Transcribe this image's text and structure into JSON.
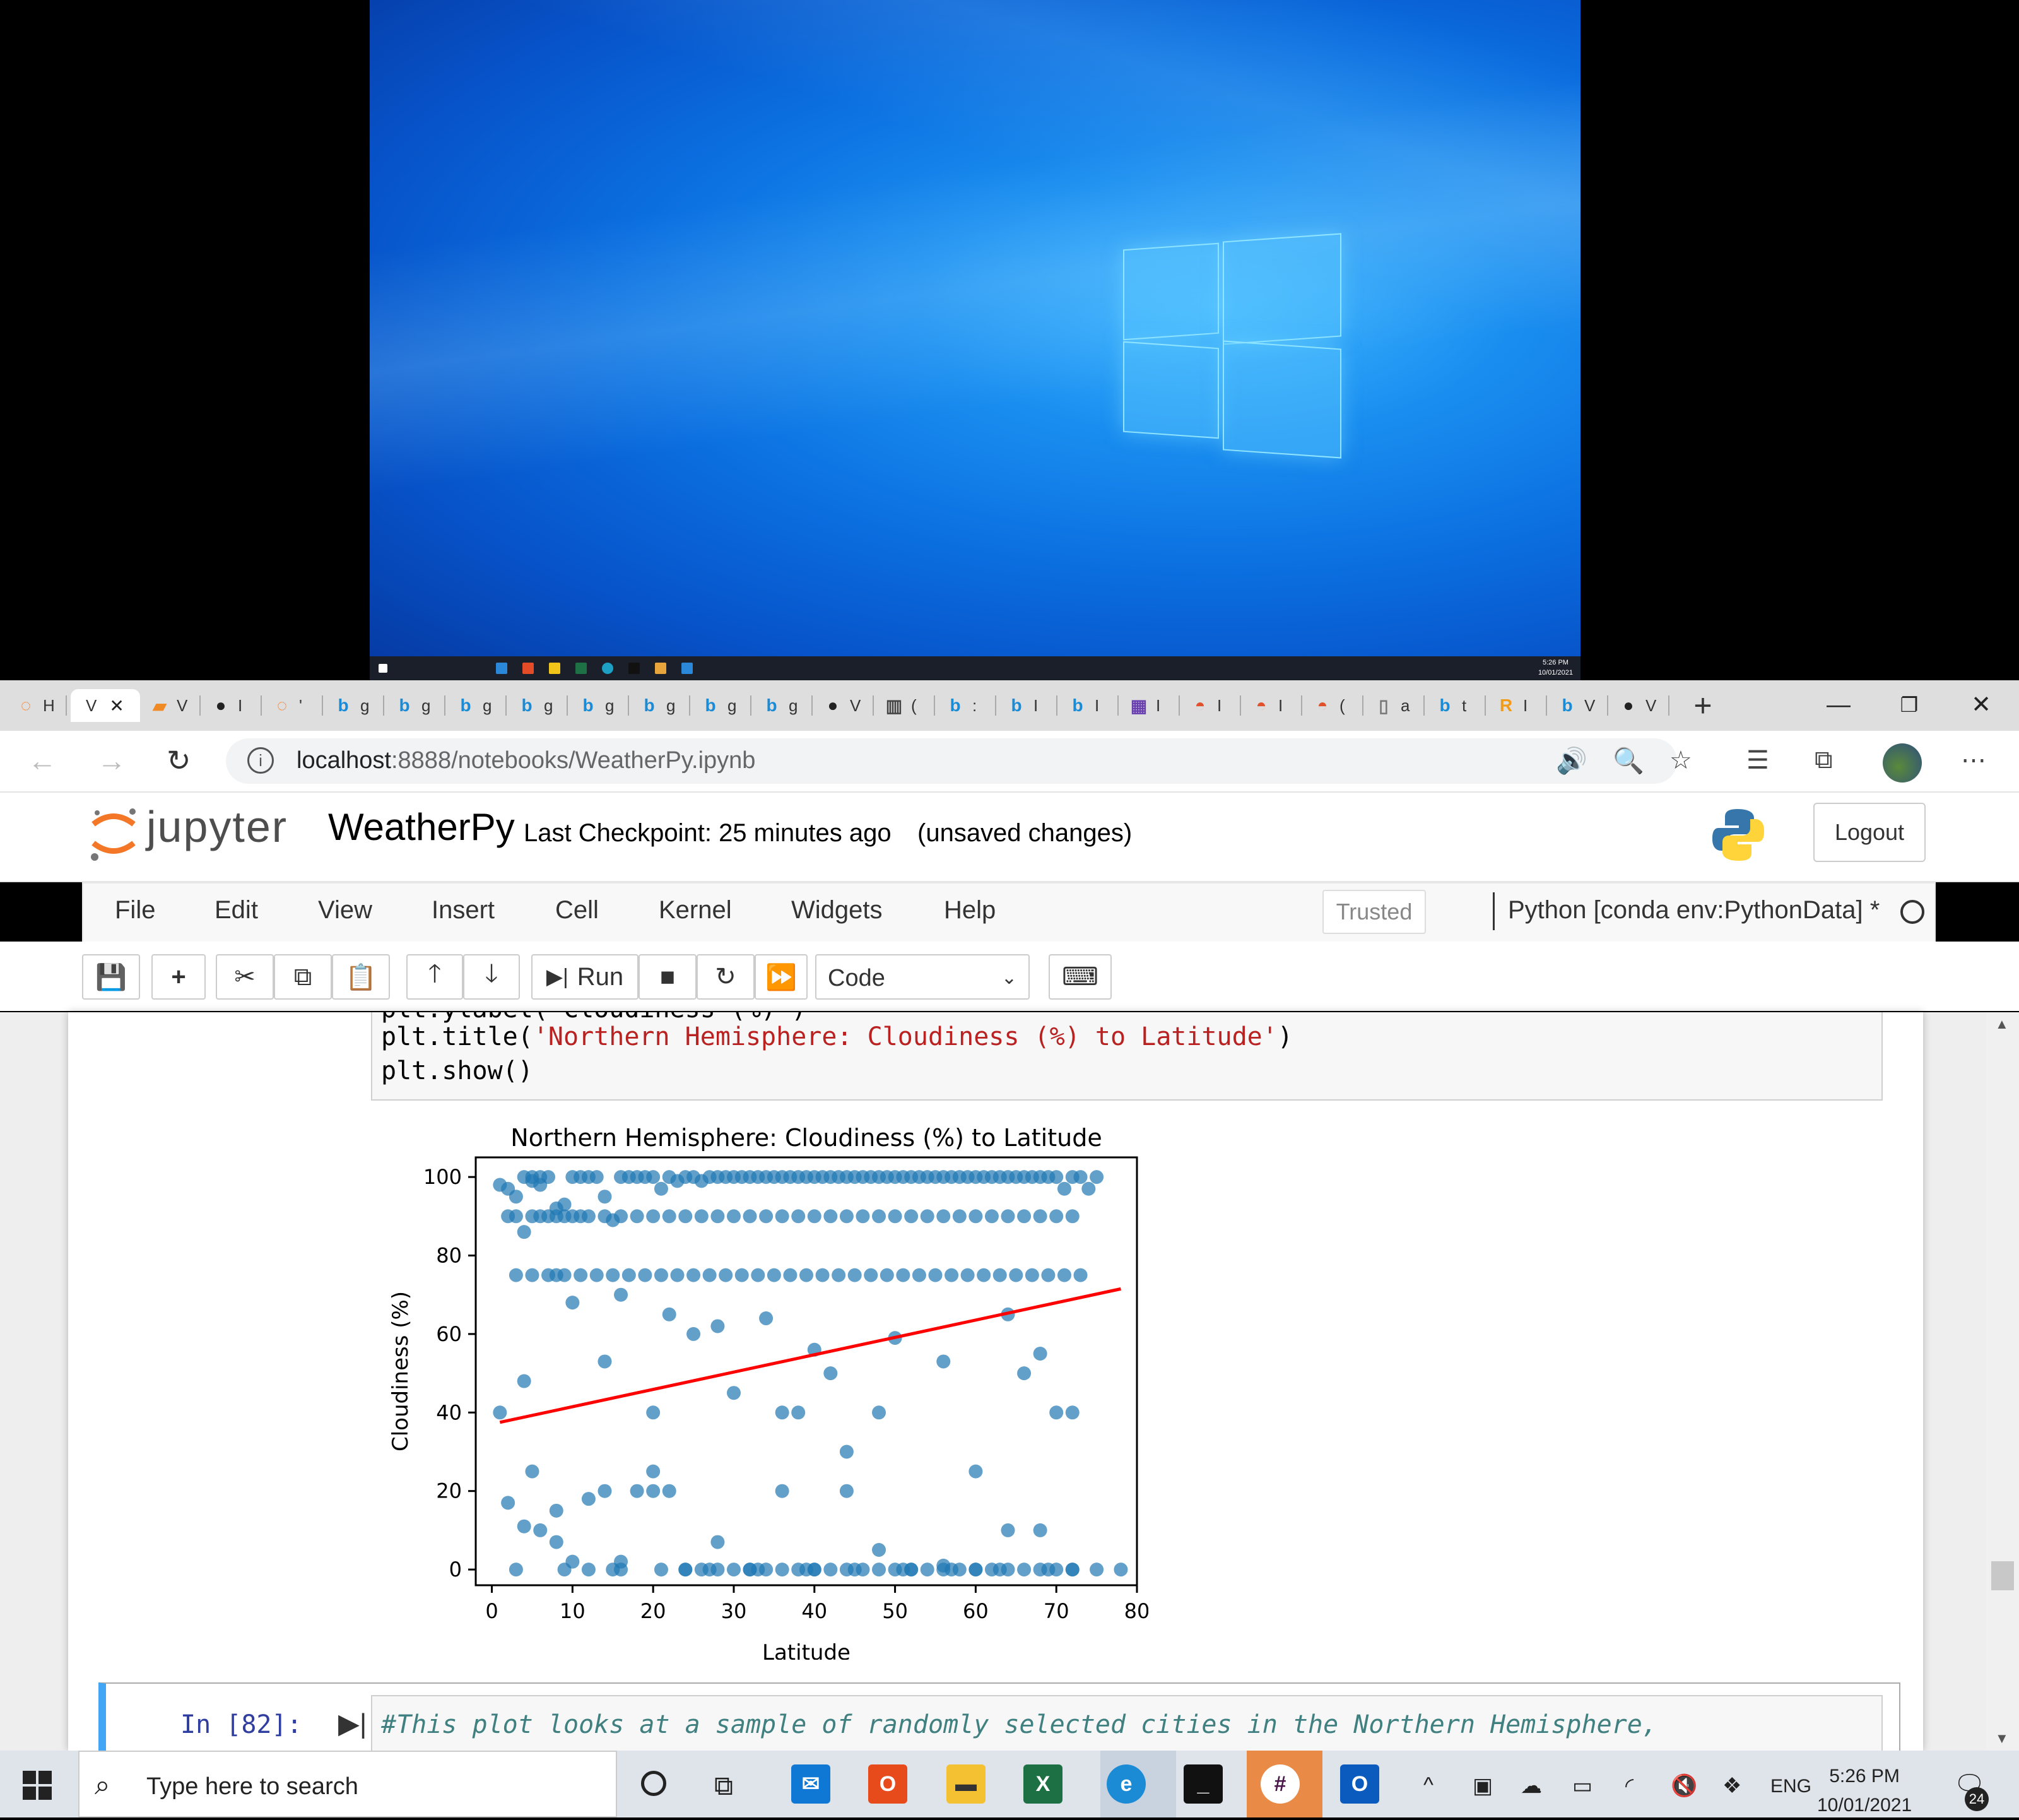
{
  "browser": {
    "tabs": [
      {
        "icon": "jupyter-icon",
        "letter": "H"
      },
      {
        "icon": "active-tab",
        "letter": "V"
      },
      {
        "icon": "book-icon",
        "letter": "V"
      },
      {
        "icon": "github-icon",
        "letter": "I"
      },
      {
        "icon": "jupyter-icon",
        "letter": "'"
      },
      {
        "icon": "bing-icon",
        "letter": "g"
      },
      {
        "icon": "bing-icon",
        "letter": "g"
      },
      {
        "icon": "bing-icon",
        "letter": "g"
      },
      {
        "icon": "bing-icon",
        "letter": "g"
      },
      {
        "icon": "bing-icon",
        "letter": "g"
      },
      {
        "icon": "bing-icon",
        "letter": "g"
      },
      {
        "icon": "bing-icon",
        "letter": "g"
      },
      {
        "icon": "bing-icon",
        "letter": "g"
      },
      {
        "icon": "github-icon",
        "letter": "V"
      },
      {
        "icon": "reader-icon",
        "letter": "("
      },
      {
        "icon": "bing-icon",
        "letter": ":"
      },
      {
        "icon": "bing-icon",
        "letter": "I"
      },
      {
        "icon": "bing-icon",
        "letter": "I"
      },
      {
        "icon": "app-icon",
        "letter": "I"
      },
      {
        "icon": "sun-icon",
        "letter": "I"
      },
      {
        "icon": "sun-icon",
        "letter": "I"
      },
      {
        "icon": "sun-icon",
        "letter": "("
      },
      {
        "icon": "doc-icon",
        "letter": "a"
      },
      {
        "icon": "bing-icon",
        "letter": "t"
      },
      {
        "icon": "r-icon",
        "letter": "I"
      },
      {
        "icon": "bing-icon",
        "letter": "V"
      },
      {
        "icon": "github-icon",
        "letter": "V"
      }
    ],
    "active_tab_close": "✕",
    "new_tab": "+",
    "url_host": "localhost",
    "url_path": ":8888/notebooks/WeatherPy.ipynb"
  },
  "jupyter": {
    "logo_text": "jupyter",
    "notebook_name": "WeatherPy",
    "checkpoint": "Last Checkpoint: 25 minutes ago",
    "unsaved": "(unsaved changes)",
    "logout": "Logout",
    "menus": [
      "File",
      "Edit",
      "View",
      "Insert",
      "Cell",
      "Kernel",
      "Widgets",
      "Help"
    ],
    "trusted": "Trusted",
    "kernel": "Python [conda env:PythonData] *",
    "run_label": "Run",
    "cell_type": "Code"
  },
  "cells": {
    "code_partial_top": "plt.ylabel('Cloudiness (%)')",
    "code_title_prefix": "plt.title(",
    "code_title_string": "'Northern Hemisphere: Cloudiness (%) to Latitude'",
    "code_title_suffix": ")",
    "code_show": "plt.show()",
    "next_prompt": "In [82]:",
    "next_comment": "#This plot looks at a sample of randomly selected cities in the Northern Hemisphere,"
  },
  "chart_data": {
    "type": "scatter",
    "title": "Northern Hemisphere: Cloudiness (%) to Latitude",
    "xlabel": "Latitude",
    "ylabel": "Cloudiness (%)",
    "xlim": [
      -2,
      80
    ],
    "ylim": [
      -4,
      105
    ],
    "xticks": [
      0,
      10,
      20,
      30,
      40,
      50,
      60,
      70,
      80
    ],
    "yticks": [
      0,
      20,
      40,
      60,
      80,
      100
    ],
    "point_color": "#1f77b4",
    "regression_color": "#ff0000",
    "regression_line": {
      "x": [
        1,
        78
      ],
      "y": [
        37.5,
        71.5
      ]
    },
    "points": {
      "x": [
        1,
        2,
        3,
        4,
        5,
        5,
        6,
        6,
        7,
        8,
        9,
        10,
        11,
        12,
        13,
        14,
        15,
        16,
        17,
        18,
        19,
        20,
        21,
        22,
        23,
        24,
        25,
        26,
        27,
        28,
        29,
        30,
        31,
        32,
        33,
        34,
        35,
        36,
        37,
        38,
        39,
        40,
        41,
        42,
        43,
        44,
        45,
        46,
        47,
        48,
        49,
        50,
        51,
        52,
        53,
        54,
        55,
        56,
        57,
        58,
        59,
        60,
        61,
        62,
        63,
        64,
        65,
        66,
        67,
        68,
        69,
        70,
        71,
        72,
        73,
        74,
        75,
        78,
        2,
        3,
        4,
        5,
        6,
        7,
        8,
        9,
        10,
        11,
        12,
        14,
        16,
        18,
        20,
        22,
        24,
        26,
        28,
        30,
        32,
        34,
        36,
        38,
        40,
        42,
        44,
        46,
        48,
        50,
        52,
        54,
        56,
        58,
        60,
        62,
        64,
        66,
        68,
        70,
        72,
        3,
        5,
        7,
        9,
        11,
        13,
        15,
        17,
        19,
        21,
        23,
        25,
        27,
        29,
        31,
        33,
        35,
        37,
        39,
        41,
        43,
        45,
        47,
        49,
        51,
        53,
        55,
        57,
        59,
        61,
        63,
        65,
        67,
        69,
        71,
        73,
        1,
        4,
        8,
        10,
        14,
        16,
        20,
        22,
        25,
        28,
        30,
        34,
        36,
        38,
        40,
        42,
        44,
        48,
        50,
        56,
        60,
        64,
        66,
        68,
        70,
        72,
        2,
        4,
        6,
        8,
        10,
        12,
        14,
        16,
        18,
        20,
        22,
        24,
        26,
        28,
        30,
        32,
        34,
        36,
        38,
        40,
        42,
        44,
        46,
        48,
        50,
        52,
        54,
        56,
        58,
        60,
        62,
        64,
        66,
        68,
        70,
        72,
        5,
        8,
        12,
        16,
        20,
        24,
        28,
        32,
        36,
        40,
        44,
        48,
        52,
        56,
        60,
        64,
        68,
        72,
        3,
        9,
        15,
        21,
        27,
        33,
        39,
        45,
        51,
        57,
        63,
        69,
        75
      ],
      "y": [
        98,
        97,
        95,
        100,
        99,
        100,
        100,
        98,
        100,
        92,
        93,
        100,
        100,
        100,
        100,
        95,
        89,
        100,
        100,
        100,
        100,
        100,
        97,
        100,
        99,
        100,
        100,
        99,
        100,
        100,
        100,
        100,
        100,
        100,
        100,
        100,
        100,
        100,
        100,
        100,
        100,
        100,
        100,
        100,
        100,
        100,
        100,
        100,
        100,
        100,
        100,
        100,
        100,
        100,
        100,
        100,
        100,
        100,
        100,
        100,
        100,
        100,
        100,
        100,
        100,
        100,
        100,
        100,
        100,
        100,
        100,
        100,
        97,
        100,
        100,
        97,
        100,
        0,
        90,
        90,
        86,
        90,
        90,
        90,
        90,
        90,
        90,
        90,
        90,
        90,
        90,
        90,
        90,
        90,
        90,
        90,
        90,
        90,
        90,
        90,
        90,
        90,
        90,
        90,
        90,
        90,
        90,
        90,
        90,
        90,
        90,
        90,
        90,
        90,
        90,
        90,
        90,
        90,
        90,
        75,
        75,
        75,
        75,
        75,
        75,
        75,
        75,
        75,
        75,
        75,
        75,
        75,
        75,
        75,
        75,
        75,
        75,
        75,
        75,
        75,
        75,
        75,
        75,
        75,
        75,
        75,
        75,
        75,
        75,
        75,
        75,
        75,
        75,
        75,
        75,
        40,
        48,
        75,
        68,
        53,
        70,
        40,
        65,
        60,
        62,
        45,
        64,
        40,
        40,
        56,
        50,
        30,
        40,
        59,
        53,
        25,
        65,
        50,
        55,
        40,
        40,
        17,
        11,
        10,
        15,
        2,
        18,
        20,
        2,
        20,
        20,
        20,
        0,
        0,
        0,
        0,
        0,
        0,
        0,
        0,
        0,
        0,
        0,
        0,
        0,
        0,
        0,
        0,
        0,
        0,
        0,
        0,
        0,
        0,
        0,
        0,
        0,
        25,
        7,
        0,
        0,
        25,
        0,
        7,
        0,
        20,
        0,
        20,
        5,
        0,
        1,
        0,
        10,
        10,
        0,
        0,
        0,
        0,
        0,
        0,
        0,
        0,
        0,
        0,
        0,
        0,
        0,
        0
      ]
    }
  },
  "taskbar": {
    "search_placeholder": "Type here to search",
    "lang": "ENG",
    "time": "5:26 PM",
    "date": "10/01/2021",
    "notifications": "24"
  },
  "rdp": {
    "time": "5:26 PM",
    "date": "10/01/2021"
  }
}
